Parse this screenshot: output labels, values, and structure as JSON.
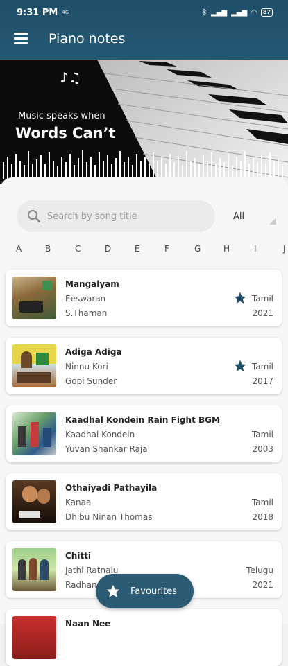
{
  "status": {
    "time": "9:31 PM",
    "network_small": "4G",
    "battery": "87"
  },
  "toolbar": {
    "title": "Piano notes"
  },
  "hero": {
    "note_symbol": "♪♫",
    "tagline": "Music speaks when",
    "tagline_big": "Words Can’t"
  },
  "search": {
    "placeholder": "Search by song title",
    "filter_value": "All"
  },
  "alphabet": [
    "A",
    "B",
    "C",
    "D",
    "E",
    "F",
    "G",
    "H",
    "I",
    "J"
  ],
  "songs": [
    {
      "title": "Mangalyam",
      "movie": "Eeswaran",
      "composer": "S.Thaman",
      "language": "Tamil",
      "year": "2021",
      "favourite": true
    },
    {
      "title": "Adiga Adiga",
      "movie": "Ninnu Kori",
      "composer": "Gopi Sunder",
      "language": "Tamil",
      "year": "2017",
      "favourite": true
    },
    {
      "title": "Kaadhal Kondein Rain Fight BGM",
      "movie": "Kaadhal Kondein",
      "composer": "Yuvan Shankar Raja",
      "language": "Tamil",
      "year": "2003",
      "favourite": false
    },
    {
      "title": "Othaiyadi Pathayila",
      "movie": "Kanaa",
      "composer": "Dhibu Ninan Thomas",
      "language": "Tamil",
      "year": "2018",
      "favourite": false
    },
    {
      "title": "Chitti",
      "movie": "Jathi Ratnalu",
      "composer": "Radhan",
      "language": "Telugu",
      "year": "2021",
      "favourite": false
    },
    {
      "title": "Naan Nee",
      "movie": "",
      "composer": "",
      "language": "",
      "year": "",
      "favourite": false
    }
  ],
  "fab": {
    "label": "Favourites"
  },
  "colors": {
    "primary": "#245873",
    "accent": "#1f4e68",
    "star": "#1f4e68"
  }
}
